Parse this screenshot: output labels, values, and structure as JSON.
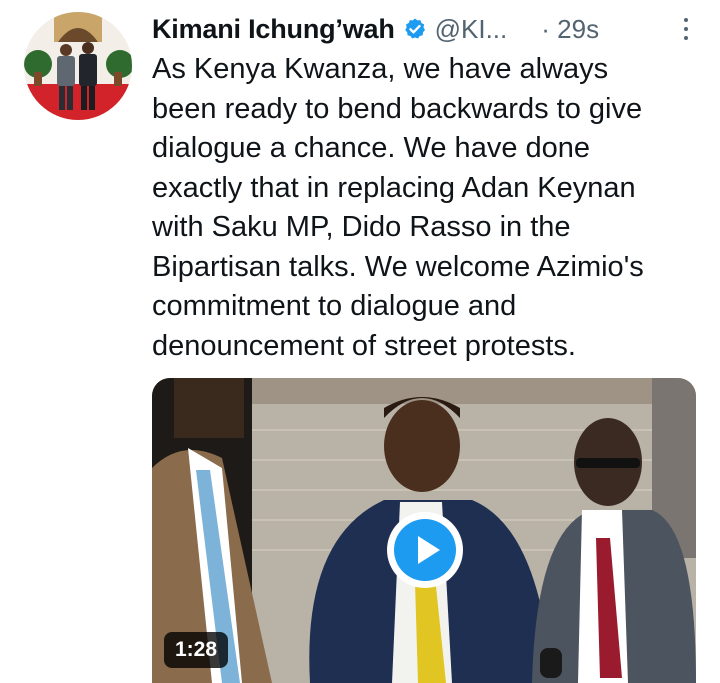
{
  "tweet": {
    "author_name": "Kimani Ichung’wah",
    "handle": "@KI...",
    "time": "· 29s",
    "text": "As Kenya Kwanza, we have always\nbeen ready to bend backwards to give\ndialogue a chance. We have done\nexactly that in replacing Adan Keynan\nwith Saku MP, Dido Rasso in the\nBipartisan talks. We welcome Azimio's\ncommitment to dialogue and\ndenouncement of street protests.",
    "verified_icon": "verified-badge-icon",
    "more_icon": "more-options-icon"
  },
  "media": {
    "duration": "1:28",
    "play_icon": "play-icon",
    "accent_color": "#1d9bf0"
  }
}
